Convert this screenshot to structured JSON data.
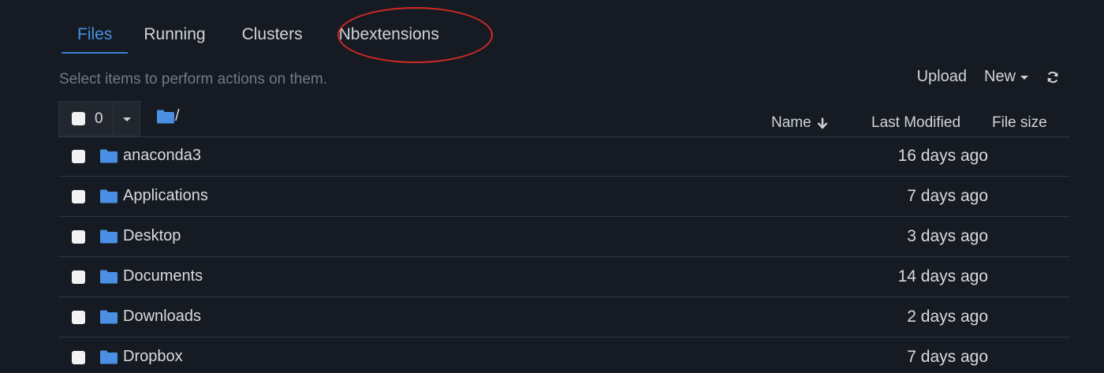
{
  "tabs": [
    {
      "label": "Files",
      "active": true
    },
    {
      "label": "Running",
      "active": false
    },
    {
      "label": "Clusters",
      "active": false
    },
    {
      "label": "Nbextensions",
      "active": false
    }
  ],
  "toolbar": {
    "hint": "Select items to perform actions on them.",
    "upload_label": "Upload",
    "new_label": "New"
  },
  "header": {
    "selected_count": "0",
    "breadcrumb_path": "/",
    "col_name": "Name",
    "col_modified": "Last Modified",
    "col_size": "File size"
  },
  "files": [
    {
      "name": "anaconda3",
      "modified": "16 days ago"
    },
    {
      "name": "Applications",
      "modified": "7 days ago"
    },
    {
      "name": "Desktop",
      "modified": "3 days ago"
    },
    {
      "name": "Documents",
      "modified": "14 days ago"
    },
    {
      "name": "Downloads",
      "modified": "2 days ago"
    },
    {
      "name": "Dropbox",
      "modified": "7 days ago"
    }
  ],
  "colors": {
    "background": "#161b23",
    "accent": "#4a8fe3",
    "folder": "#4a8fe3",
    "annotation_ellipse": "#d42a25"
  }
}
